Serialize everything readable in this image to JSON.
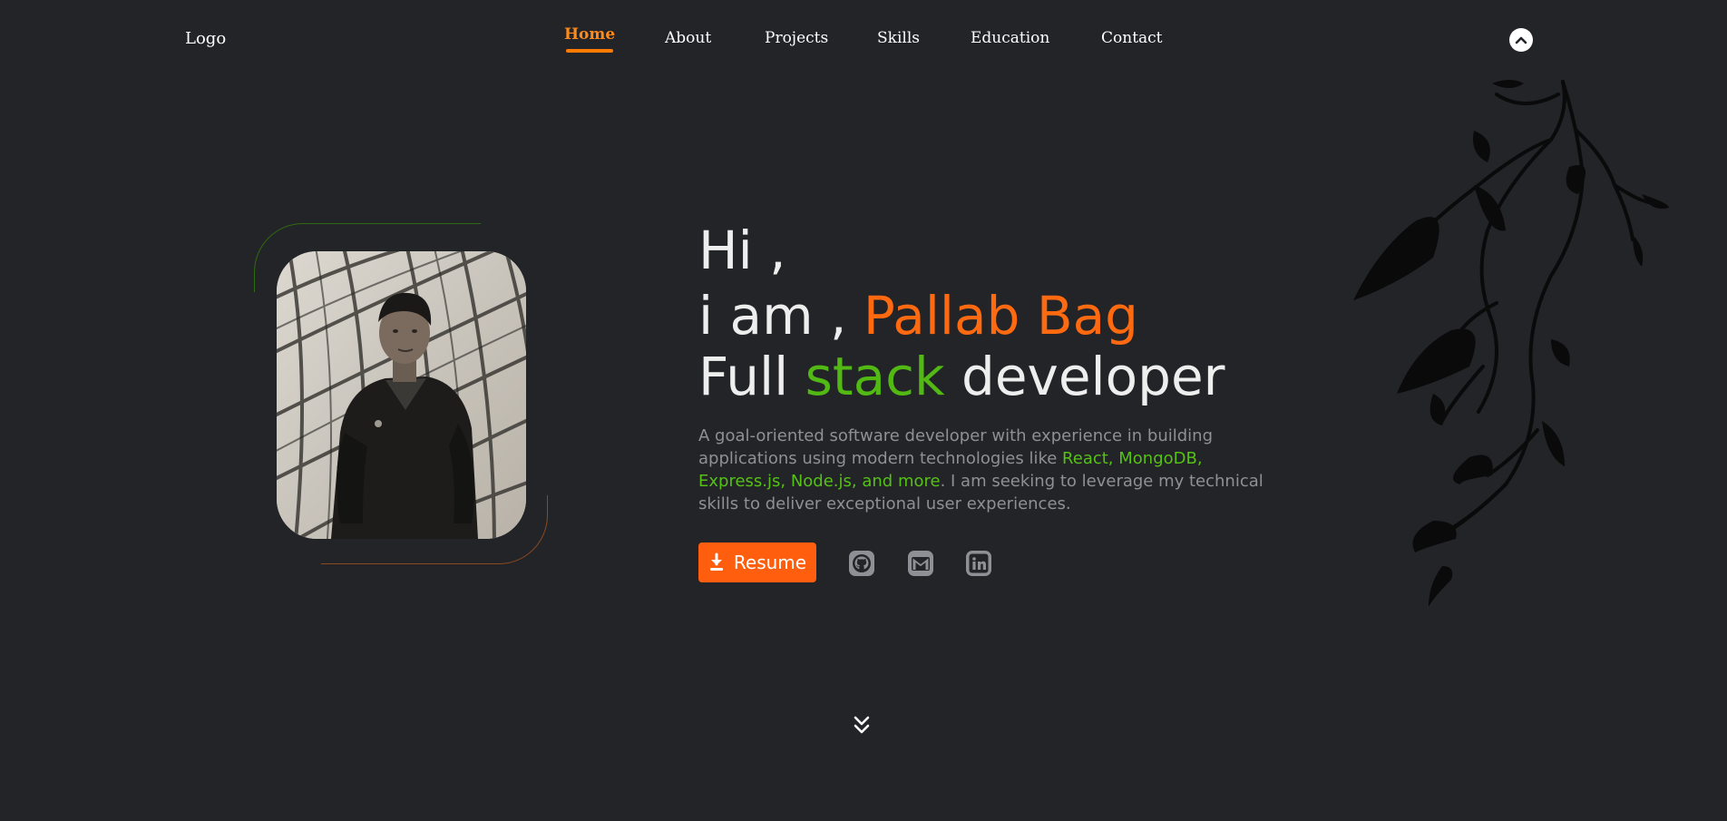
{
  "nav": {
    "logo": "Logo",
    "items": [
      {
        "label": "Home",
        "active": true
      },
      {
        "label": "About",
        "active": false
      },
      {
        "label": "Projects",
        "active": false
      },
      {
        "label": "Skills",
        "active": false
      },
      {
        "label": "Education",
        "active": false
      },
      {
        "label": "Contact",
        "active": false
      }
    ],
    "scroll_top_icon": "chevron-up-circle-icon"
  },
  "hero": {
    "greeting": "Hi ,",
    "intro_prefix": "i am ,",
    "name": "Pallab Bag",
    "role_word1": "Full",
    "role_word2": "stack",
    "role_word3": "developer",
    "desc_part1": "A goal-oriented software developer with experience in building applications using modern technologies like ",
    "desc_tech": "React, MongoDB, Express.js, Node.js, and more",
    "desc_part2": ". I am seeking to leverage my technical skills to deliver exceptional user experiences."
  },
  "actions": {
    "resume_label": "Resume",
    "resume_icon": "download-icon",
    "socials": [
      "github-icon",
      "gmail-icon",
      "linkedin-icon"
    ]
  },
  "scroll_down_icon": "double-chevron-down-icon",
  "colors": {
    "background": "#232428",
    "accent_orange": "#ff5e0e",
    "accent_green": "#52b813",
    "text_light": "#eeeeee",
    "text_muted": "#8e9096"
  }
}
